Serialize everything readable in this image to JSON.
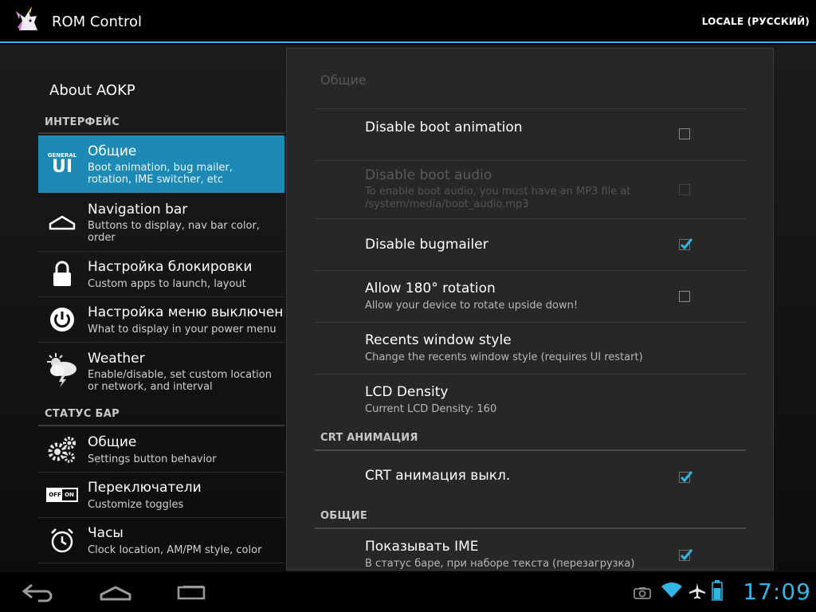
{
  "app": {
    "title": "ROM Control",
    "locale_button": "LOCALE (РУССКИЙ)",
    "accent": "#33b5e5"
  },
  "sidebar": {
    "about": "About AOKP",
    "categories": [
      {
        "label": "ИНТЕРФЕЙС",
        "items": [
          {
            "icon": "general-ui-icon",
            "icon_text": [
              "GENERAL",
              "UI"
            ],
            "title": "Общие",
            "summary": "Boot animation, bug mailer, rotation, IME switcher, etc",
            "selected": true
          },
          {
            "icon": "nav-bar-icon",
            "title": "Navigation bar",
            "summary": "Buttons to display, nav bar color, order"
          },
          {
            "icon": "lock-icon",
            "title": "Настройка блокировки",
            "summary": "Custom apps to launch, layout"
          },
          {
            "icon": "power-icon",
            "title": "Настройка меню выключения",
            "summary": "What to display in your power menu"
          },
          {
            "icon": "weather-icon",
            "title": "Weather",
            "summary": "Enable/disable, set custom location or network, and interval"
          }
        ]
      },
      {
        "label": "СТАТУС БАР",
        "items": [
          {
            "icon": "gears-icon",
            "title": "Общие",
            "summary": "Settings button behavior"
          },
          {
            "icon": "toggles-icon",
            "icon_text": [
              "OFF",
              "ON"
            ],
            "title": "Переключатели",
            "summary": "Customize toggles"
          },
          {
            "icon": "alarm-clock-icon",
            "title": "Часы",
            "summary": "Clock location, AM/PM style, color"
          }
        ]
      }
    ]
  },
  "panel": {
    "breadcrumb": "Общие",
    "prefs": [
      {
        "title": "Disable boot animation",
        "summary": "",
        "checked": false
      },
      {
        "title": "Disable boot audio",
        "summary": [
          "To enable boot audio, you must have an MP3 file at",
          "/system/media/boot_audio.mp3"
        ],
        "checked": false,
        "disabled": true
      },
      {
        "title": "Disable bugmailer",
        "summary": "",
        "checked": true
      },
      {
        "title": "Allow 180° rotation",
        "summary": "Allow your device to rotate upside down!",
        "checked": false
      },
      {
        "title": "Recents window style",
        "summary": "Change the recents window style (requires UI restart)"
      },
      {
        "title": "LCD Density",
        "summary": "Current LCD Density: 160"
      }
    ],
    "crt_category": "CRT АНИМАЦИЯ",
    "crt_pref": {
      "title": "CRT анимация выкл.",
      "checked": true
    },
    "general_category": "ОБЩИЕ",
    "ime_pref": {
      "title": "Показывать IME",
      "summary": "В статус баре, при наборе текста (перезагрузка)",
      "checked": true
    }
  },
  "navbar": {
    "time": "17:09"
  }
}
